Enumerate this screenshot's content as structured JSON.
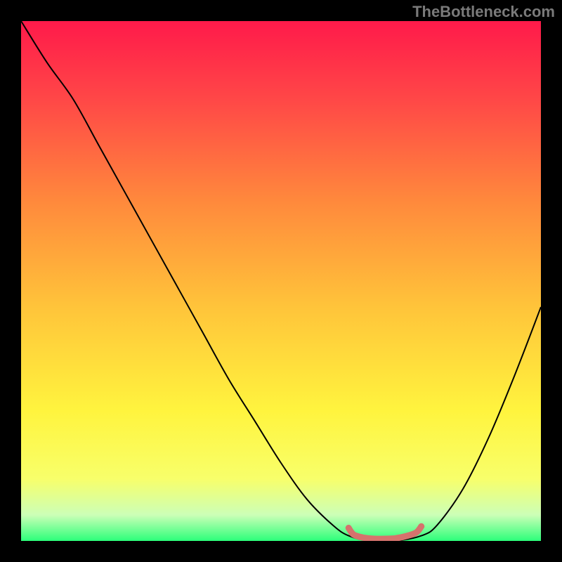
{
  "attribution": "TheBottleneck.com",
  "chart_data": {
    "type": "line",
    "title": "",
    "xlabel": "",
    "ylabel": "",
    "xlim": [
      0,
      100
    ],
    "ylim": [
      0,
      100
    ],
    "series": [
      {
        "name": "bottleneck-curve",
        "color": "#000000",
        "x": [
          0,
          5,
          10,
          15,
          20,
          25,
          30,
          35,
          40,
          45,
          50,
          55,
          60,
          63,
          67,
          72,
          77,
          80,
          85,
          90,
          95,
          100
        ],
        "y": [
          100,
          92,
          85,
          76,
          67,
          58,
          49,
          40,
          31,
          23,
          15,
          8,
          3,
          1,
          0,
          0,
          1,
          3,
          10,
          20,
          32,
          45
        ]
      },
      {
        "name": "optimal-range-marker",
        "color": "#d6726d",
        "x": [
          63,
          64,
          66,
          68,
          70,
          72,
          74,
          76,
          77
        ],
        "y": [
          2.5,
          1.2,
          0.6,
          0.4,
          0.4,
          0.5,
          0.9,
          1.6,
          2.8
        ]
      }
    ],
    "background": {
      "type": "vertical-gradient",
      "stops": [
        {
          "pos": 0.0,
          "color": "#ff1a4a"
        },
        {
          "pos": 0.15,
          "color": "#ff4747"
        },
        {
          "pos": 0.35,
          "color": "#ff8a3c"
        },
        {
          "pos": 0.55,
          "color": "#ffc43a"
        },
        {
          "pos": 0.75,
          "color": "#fff43e"
        },
        {
          "pos": 0.88,
          "color": "#f8ff6a"
        },
        {
          "pos": 0.95,
          "color": "#ccffb7"
        },
        {
          "pos": 1.0,
          "color": "#2cff7a"
        }
      ]
    }
  }
}
